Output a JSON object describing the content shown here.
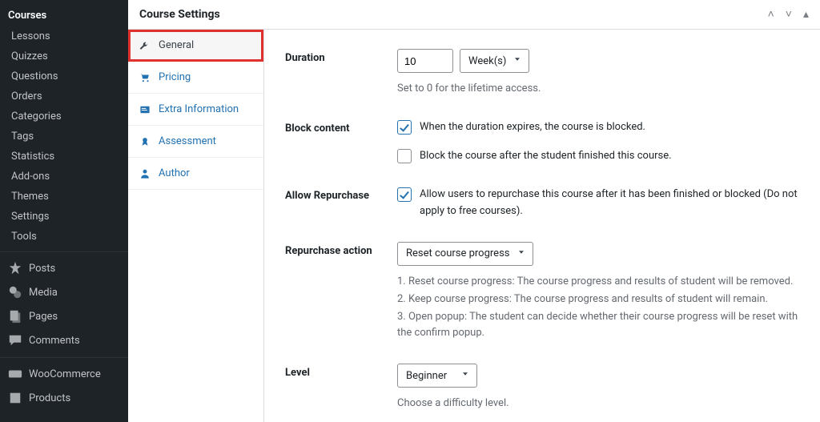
{
  "admin_menu": {
    "current": "Courses",
    "course_sub": [
      "Lessons",
      "Quizzes",
      "Questions",
      "Orders",
      "Categories",
      "Tags",
      "Statistics",
      "Add-ons",
      "Themes",
      "Settings",
      "Tools"
    ],
    "tools": [
      {
        "label": "Posts"
      },
      {
        "label": "Media"
      },
      {
        "label": "Pages"
      },
      {
        "label": "Comments"
      },
      {
        "label": "WooCommerce"
      },
      {
        "label": "Products"
      }
    ]
  },
  "panel": {
    "title": "Course Settings"
  },
  "tabs": [
    {
      "id": "general",
      "label": "General"
    },
    {
      "id": "pricing",
      "label": "Pricing"
    },
    {
      "id": "extra",
      "label": "Extra Information"
    },
    {
      "id": "assess",
      "label": "Assessment"
    },
    {
      "id": "author",
      "label": "Author"
    }
  ],
  "form": {
    "duration": {
      "label": "Duration",
      "value": "10",
      "unit": "Week(s)",
      "hint": "Set to 0 for the lifetime access."
    },
    "block_content": {
      "label": "Block content",
      "opt_expire": {
        "checked": true,
        "text": "When the duration expires, the course is blocked."
      },
      "opt_finish": {
        "checked": false,
        "text": "Block the course after the student finished this course."
      }
    },
    "allow_repurchase": {
      "label": "Allow Repurchase",
      "opt": {
        "checked": true,
        "text": "Allow users to repurchase this course after it has been finished or blocked (Do not apply to free courses)."
      }
    },
    "repurchase_action": {
      "label": "Repurchase action",
      "value": "Reset course progress",
      "hint1": "1. Reset course progress: The course progress and results of student will be removed.",
      "hint2": "2. Keep course progress: The course progress and results of student will remain.",
      "hint3": "3. Open popup: The student can decide whether their course progress will be reset with the confirm popup."
    },
    "level": {
      "label": "Level",
      "value": "Beginner",
      "hint": "Choose a difficulty level."
    }
  }
}
